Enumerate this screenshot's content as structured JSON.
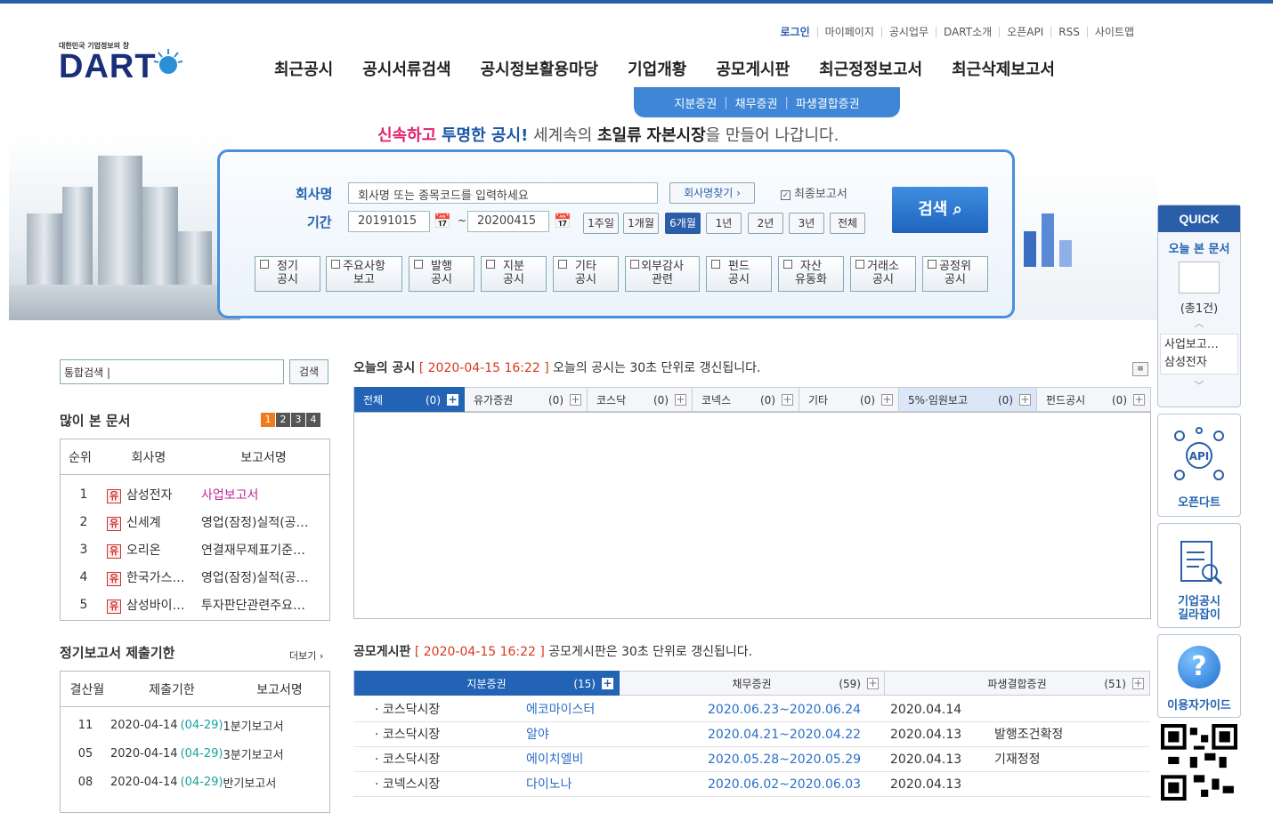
{
  "utility_links": [
    "로그인",
    "마이페이지",
    "공시업무",
    "DART소개",
    "오픈API",
    "RSS",
    "사이트맵"
  ],
  "logo": {
    "tagline": "대한민국 기업정보의 창",
    "word": "DART"
  },
  "main_nav": [
    "최근공시",
    "공시서류검색",
    "공시정보활용마당",
    "기업개황",
    "공모게시판",
    "최근정정보고서",
    "최근삭제보고서"
  ],
  "sub_nav": [
    "지분증권",
    "채무증권",
    "파생결합증권"
  ],
  "slogan": {
    "p1": "신속하고",
    "p2": "투명한 공시",
    "p3": "!",
    "p4": "세계속의",
    "p5": "초일류",
    "p6": "자본시장",
    "p7": "을 만들어 나갑니다."
  },
  "search": {
    "company_label": "회사명",
    "company_placeholder": "회사명 또는 종목코드를 입력하세요",
    "find_company_btn": "회사명찾기 ›",
    "final_report_check": "최종보고서",
    "period_label": "기간",
    "date_from": "20191015",
    "dash": "~",
    "date_to": "20200415",
    "periods": [
      "1주일",
      "1개월",
      "6개월",
      "1년",
      "2년",
      "3년",
      "전체"
    ],
    "search_btn": "검색",
    "categories": [
      [
        "정기",
        "공시"
      ],
      [
        "주요사항",
        "보고"
      ],
      [
        "발행",
        "공시"
      ],
      [
        "지분",
        "공시"
      ],
      [
        "기타",
        "공시"
      ],
      [
        "외부감사",
        "관련"
      ],
      [
        "펀드",
        "공시"
      ],
      [
        "자산",
        "유동화"
      ],
      [
        "거래소",
        "공시"
      ],
      [
        "공정위",
        "공시"
      ]
    ]
  },
  "total_search": {
    "value": "통합검색",
    "button": "검색"
  },
  "popular": {
    "title": "많이 본 문서",
    "pages": [
      "1",
      "2",
      "3",
      "4"
    ],
    "headers": [
      "순위",
      "회사명",
      "보고서명"
    ],
    "rows": [
      {
        "rank": "1",
        "badge": "유",
        "company": "삼성전자",
        "report": "사업보고서"
      },
      {
        "rank": "2",
        "badge": "유",
        "company": "신세계",
        "report": "영업(잠정)실적(공…"
      },
      {
        "rank": "3",
        "badge": "유",
        "company": "오리온",
        "report": "연결재무제표기준…"
      },
      {
        "rank": "4",
        "badge": "유",
        "company": "한국가스…",
        "report": "영업(잠정)실적(공…"
      },
      {
        "rank": "5",
        "badge": "유",
        "company": "삼성바이…",
        "report": "투자판단관련주요…"
      }
    ]
  },
  "deadline": {
    "title": "정기보고서 제출기한",
    "more": "더보기",
    "headers": [
      "결산월",
      "제출기한",
      "보고서명"
    ],
    "rows": [
      {
        "month": "11",
        "date": "2020-04-14",
        "ext": "(04-29)",
        "report": "1분기보고서"
      },
      {
        "month": "05",
        "date": "2020-04-14",
        "ext": "(04-29)",
        "report": "3분기보고서"
      },
      {
        "month": "08",
        "date": "2020-04-14",
        "ext": "(04-29)",
        "report": "반기보고서"
      }
    ]
  },
  "today": {
    "title": "오늘의 공시",
    "time": "[ 2020-04-15 16:22 ]",
    "note": "오늘의 공시는 30초 단위로 갱신됩니다.",
    "tabs": [
      {
        "label": "전체",
        "count": "(0)"
      },
      {
        "label": "유가증권",
        "count": "(0)"
      },
      {
        "label": "코스닥",
        "count": "(0)"
      },
      {
        "label": "코넥스",
        "count": "(0)"
      },
      {
        "label": "기타",
        "count": "(0)"
      },
      {
        "label": "5%·임원보고",
        "count": "(0)"
      },
      {
        "label": "펀드공시",
        "count": "(0)"
      }
    ]
  },
  "offering": {
    "title": "공모게시판",
    "time": "[ 2020-04-15 16:22 ]",
    "note": "공모게시판은 30초 단위로 갱신됩니다.",
    "tabs": [
      {
        "label": "지분증권",
        "count": "(15)"
      },
      {
        "label": "채무증권",
        "count": "(59)"
      },
      {
        "label": "파생결합증권",
        "count": "(51)"
      }
    ],
    "rows": [
      {
        "market": "· 코스닥시장",
        "company": "에코마이스터",
        "period": "2020.06.23~2020.06.24",
        "date": "2020.04.14",
        "status": ""
      },
      {
        "market": "· 코스닥시장",
        "company": "알야",
        "period": "2020.04.21~2020.04.22",
        "date": "2020.04.13",
        "status": "발행조건확정"
      },
      {
        "market": "· 코스닥시장",
        "company": "에이치엘비",
        "period": "2020.05.28~2020.05.29",
        "date": "2020.04.13",
        "status": "기재정정"
      },
      {
        "market": "· 코넥스시장",
        "company": "다이노나",
        "period": "2020.06.02~2020.06.03",
        "date": "2020.04.13",
        "status": ""
      }
    ]
  },
  "quick": {
    "title": "QUICK",
    "today_docs": "오늘 본 문서",
    "count": "(총1건)",
    "doc_line1": "사업보고…",
    "doc_line2": "삼성전자",
    "open_dart": "오픈다트",
    "guide1": "기업공시",
    "guide2": "길라잡이",
    "user_guide": "이용자가이드"
  }
}
